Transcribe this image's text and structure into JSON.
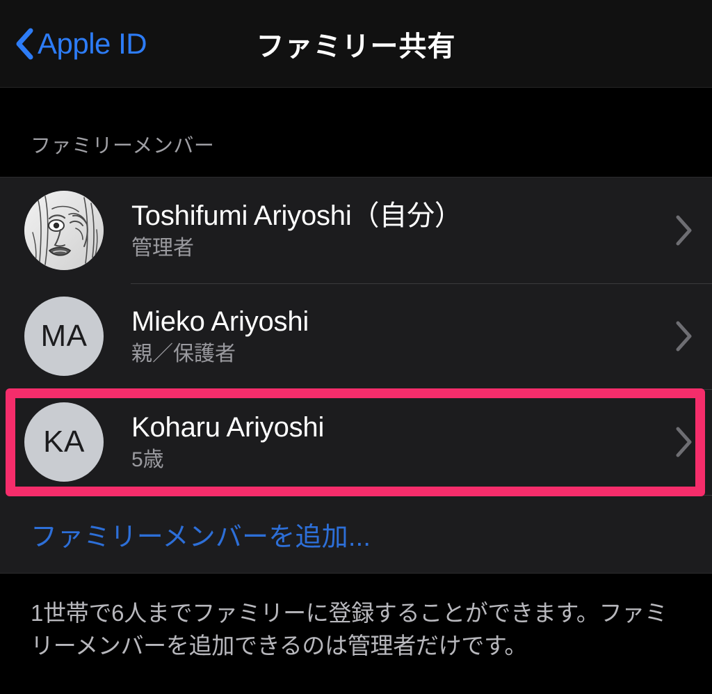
{
  "navbar": {
    "back_label": "Apple ID",
    "back_icon": "chevron-left-icon",
    "title": "ファミリー共有"
  },
  "section": {
    "header": "ファミリーメンバー"
  },
  "members": [
    {
      "name": "Toshifumi Ariyoshi（自分）",
      "role": "管理者",
      "avatar_type": "photo",
      "avatar_initials": "",
      "chevron": "chevron-right-icon",
      "highlighted": false
    },
    {
      "name": "Mieko Ariyoshi",
      "role": "親／保護者",
      "avatar_type": "initials",
      "avatar_initials": "MA",
      "chevron": "chevron-right-icon",
      "highlighted": false
    },
    {
      "name": "Koharu Ariyoshi",
      "role": "5歳",
      "avatar_type": "initials",
      "avatar_initials": "KA",
      "chevron": "chevron-right-icon",
      "highlighted": true
    }
  ],
  "add_member": {
    "label": "ファミリーメンバーを追加..."
  },
  "footer": {
    "text": "1世帯で6人までファミリーに登録することができます。ファミリーメンバーを追加できるのは管理者だけです。"
  },
  "colors": {
    "accent_blue": "#2d7cf6",
    "link_blue": "#2d6fd8",
    "highlight_pink": "#f52d6b",
    "list_background": "#1c1c1e",
    "page_background": "#000000",
    "avatar_gray": "#c9ccd1"
  }
}
